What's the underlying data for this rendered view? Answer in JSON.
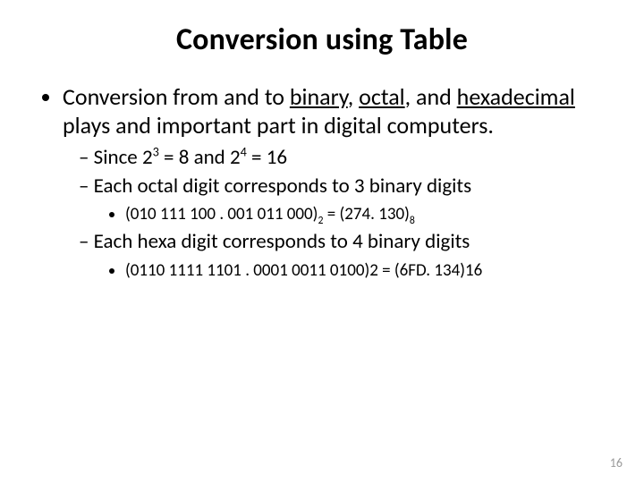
{
  "title": "Conversion using Table",
  "bullet1": {
    "pre": "Conversion from and to ",
    "t1": "binary",
    "sep1": ", ",
    "t2": "octal",
    "sep2": ", and ",
    "t3": "hexadecimal",
    "post": " plays and important part in digital computers."
  },
  "sub1": {
    "a": "Since 2",
    "e3": "3",
    "b": " = 8 and 2",
    "e4": "4",
    "c": " = 16"
  },
  "sub2": "Each octal digit corresponds to 3 binary digits",
  "ex1": {
    "a": "(010  111 100 . 001 011 000)",
    "s2": "2",
    "b": " = (274. 130)",
    "s8": "8"
  },
  "sub3": "Each hexa digit corresponds to 4 binary digits",
  "ex2": "(0110  1111 1101 . 0001 0011 0100)2 = (6FD. 134)16",
  "page_number": "16"
}
